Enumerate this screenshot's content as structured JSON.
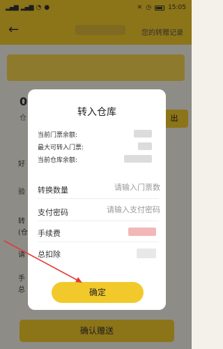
{
  "status": {
    "time": "15:05"
  },
  "header": {
    "back_icon": "back-arrow-icon",
    "link": "您的转赠记录"
  },
  "background": {
    "balance_value": "0.",
    "balance_sub": "仓",
    "out_button": "出",
    "side_texts": [
      "好",
      "验",
      "转",
      "(仓",
      "请",
      "手",
      "总"
    ],
    "bottom_button": "确认赠送"
  },
  "dialog": {
    "title": "转入仓库",
    "info": [
      {
        "label": "当前门票余额:"
      },
      {
        "label": "最大可转入门票:"
      },
      {
        "label": "当前仓库余额:"
      }
    ],
    "fields": [
      {
        "label": "转换数量",
        "placeholder": "请输入门票数"
      },
      {
        "label": "支付密码",
        "placeholder": "请输入支付密码"
      }
    ],
    "fee_label": "手续费",
    "total_label": "总扣除",
    "confirm": "确定"
  },
  "colors": {
    "accent": "#f2c92a",
    "annotation": "#e53935"
  }
}
